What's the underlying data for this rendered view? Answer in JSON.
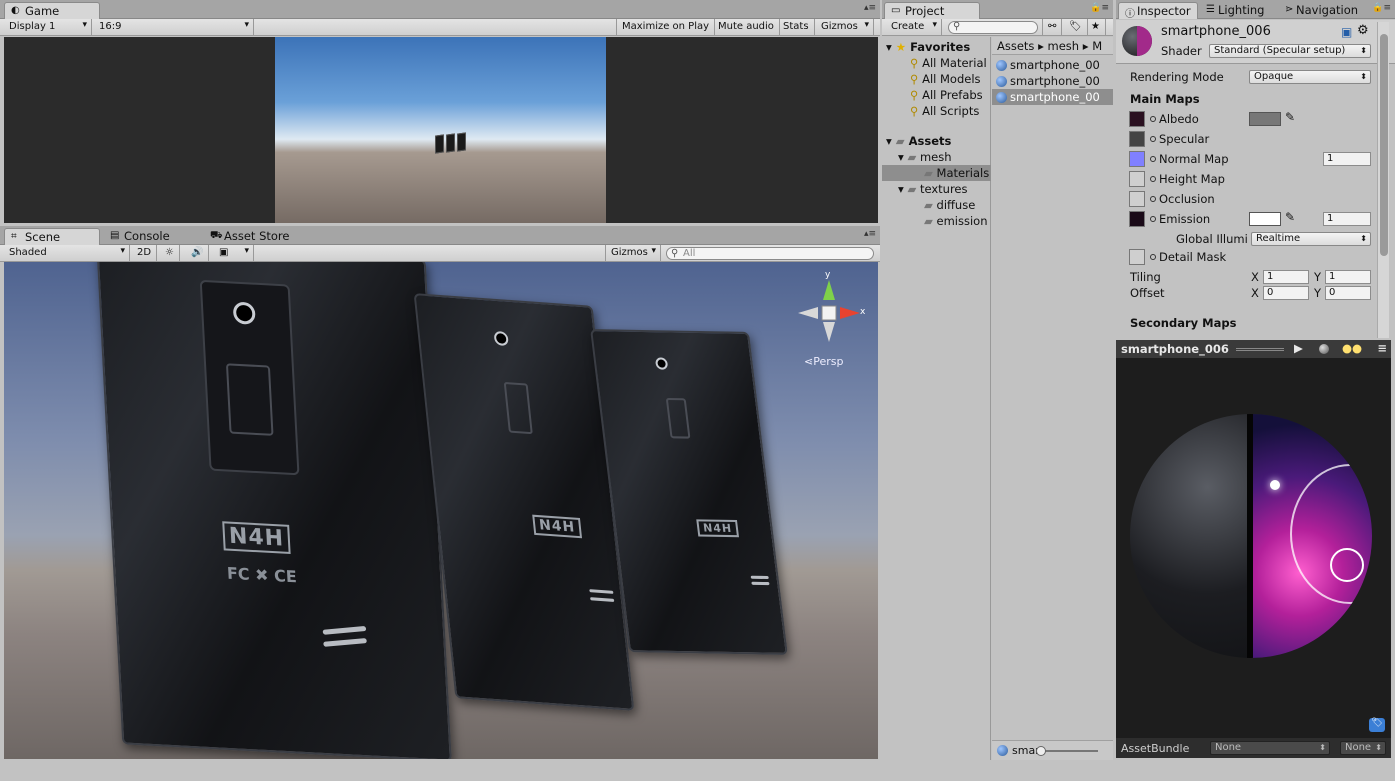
{
  "game": {
    "tab": "Game",
    "display": "Display 1",
    "aspect": "16:9",
    "maximize": "Maximize on Play",
    "mute": "Mute audio",
    "stats": "Stats",
    "gizmos": "Gizmos"
  },
  "scene": {
    "tabs": [
      "Scene",
      "Console",
      "Asset Store"
    ],
    "shading": "Shaded",
    "mode2d": "2D",
    "gizmos": "Gizmos",
    "search_placeholder": "All",
    "persp": "Persp",
    "axis_x": "x",
    "axis_y": "y",
    "phone_logo": "N4H",
    "phone_marks": "FC ✖ CE"
  },
  "project": {
    "tab": "Project",
    "create": "Create",
    "favorites": "Favorites",
    "fav_items": [
      "All Material",
      "All Models",
      "All Prefabs",
      "All Scripts"
    ],
    "assets": "Assets",
    "tree": [
      "mesh",
      "Materials",
      "textures",
      "diffuse",
      "emission"
    ],
    "breadcrumb": [
      "Assets",
      "mesh",
      "M"
    ],
    "files": [
      "smartphone_00",
      "smartphone_00",
      "smartphone_00"
    ],
    "bottom_search": "smar"
  },
  "inspector": {
    "tabs": [
      "Inspector",
      "Lighting",
      "Navigation"
    ],
    "name": "smartphone_006",
    "shader_label": "Shader",
    "shader": "Standard (Specular setup)",
    "rendering_mode_label": "Rendering Mode",
    "rendering_mode": "Opaque",
    "main_maps": "Main Maps",
    "albedo": "Albedo",
    "specular": "Specular",
    "normal": "Normal Map",
    "normal_val": "1",
    "height": "Height Map",
    "occlusion": "Occlusion",
    "emission": "Emission",
    "emission_val": "1",
    "gi_label": "Global Illumi",
    "gi": "Realtime",
    "detail": "Detail Mask",
    "tiling": "Tiling",
    "offset": "Offset",
    "x_label": "X",
    "y_label": "Y",
    "tiling_x": "1",
    "tiling_y": "1",
    "offset_x": "0",
    "offset_y": "0",
    "secondary": "Secondary Maps",
    "preview_name": "smartphone_006",
    "assetbundle": "AssetBundle",
    "bundle_none1": "None",
    "bundle_none2": "None"
  }
}
